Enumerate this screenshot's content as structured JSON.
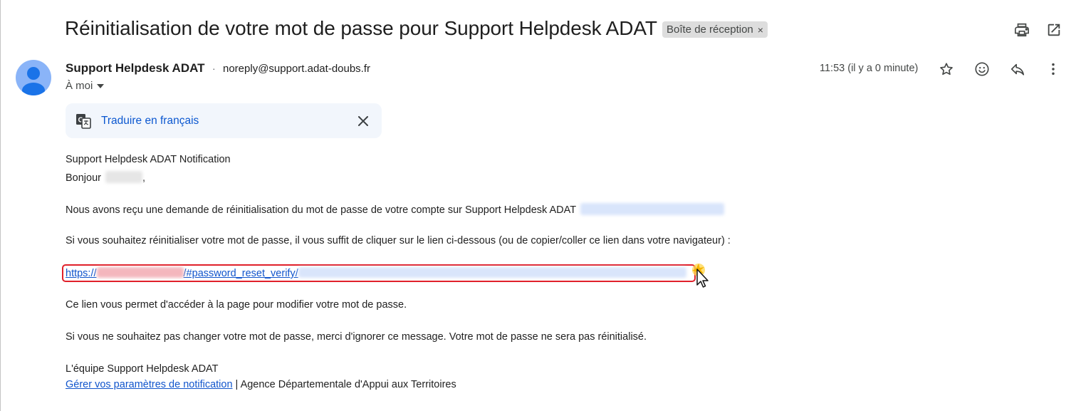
{
  "email": {
    "subject": "Réinitialisation de votre mot de passe pour Support Helpdesk ADAT",
    "label": "Boîte de réception",
    "label_close": "×",
    "sender_name": "Support Helpdesk ADAT",
    "sender_sep": "·",
    "sender_email": "noreply@support.adat-doubs.fr",
    "recipient": "À moi",
    "time": "11:53 (il y a 0 minute)"
  },
  "translate": {
    "link_label": "Traduire en français"
  },
  "body": {
    "line1": "Support Helpdesk ADAT Notification",
    "greeting": "Bonjour",
    "greeting_end": ",",
    "para1": "Nous avons reçu une demande de réinitialisation du mot de passe de votre compte sur Support Helpdesk ADAT",
    "para2": "Si vous souhaitez réinitialiser votre mot de passe, il vous suffit de cliquer sur le lien ci-dessous (ou de copier/coller ce lien dans votre navigateur) :",
    "link_prefix": "https://",
    "link_middle": "/#password_reset_verify/",
    "para3": "Ce lien vous permet d'accéder à la page pour modifier votre mot de passe.",
    "para4": "Si vous ne souhaitez pas changer votre mot de passe, merci d'ignorer ce message. Votre mot de passe ne sera pas réinitialisé.",
    "signature": "L'équipe Support Helpdesk ADAT",
    "manage_link": "Gérer vos paramètres de notification",
    "footer_sep": " | ",
    "footer_org": "Agence Départementale d'Appui aux Territoires"
  },
  "icons": {
    "print": "print-icon",
    "open_new_window": "open-in-new-window-icon",
    "star": "star-icon",
    "emoji": "emoji-reaction-icon",
    "reply": "reply-icon",
    "more": "more-vertical-icon",
    "translate": "translate-icon",
    "close": "close-icon",
    "cursor": "mouse-pointer-icon"
  },
  "colors": {
    "link": "#1155cc",
    "translate_link": "#0b57d0",
    "highlight_border": "#e0202a"
  }
}
